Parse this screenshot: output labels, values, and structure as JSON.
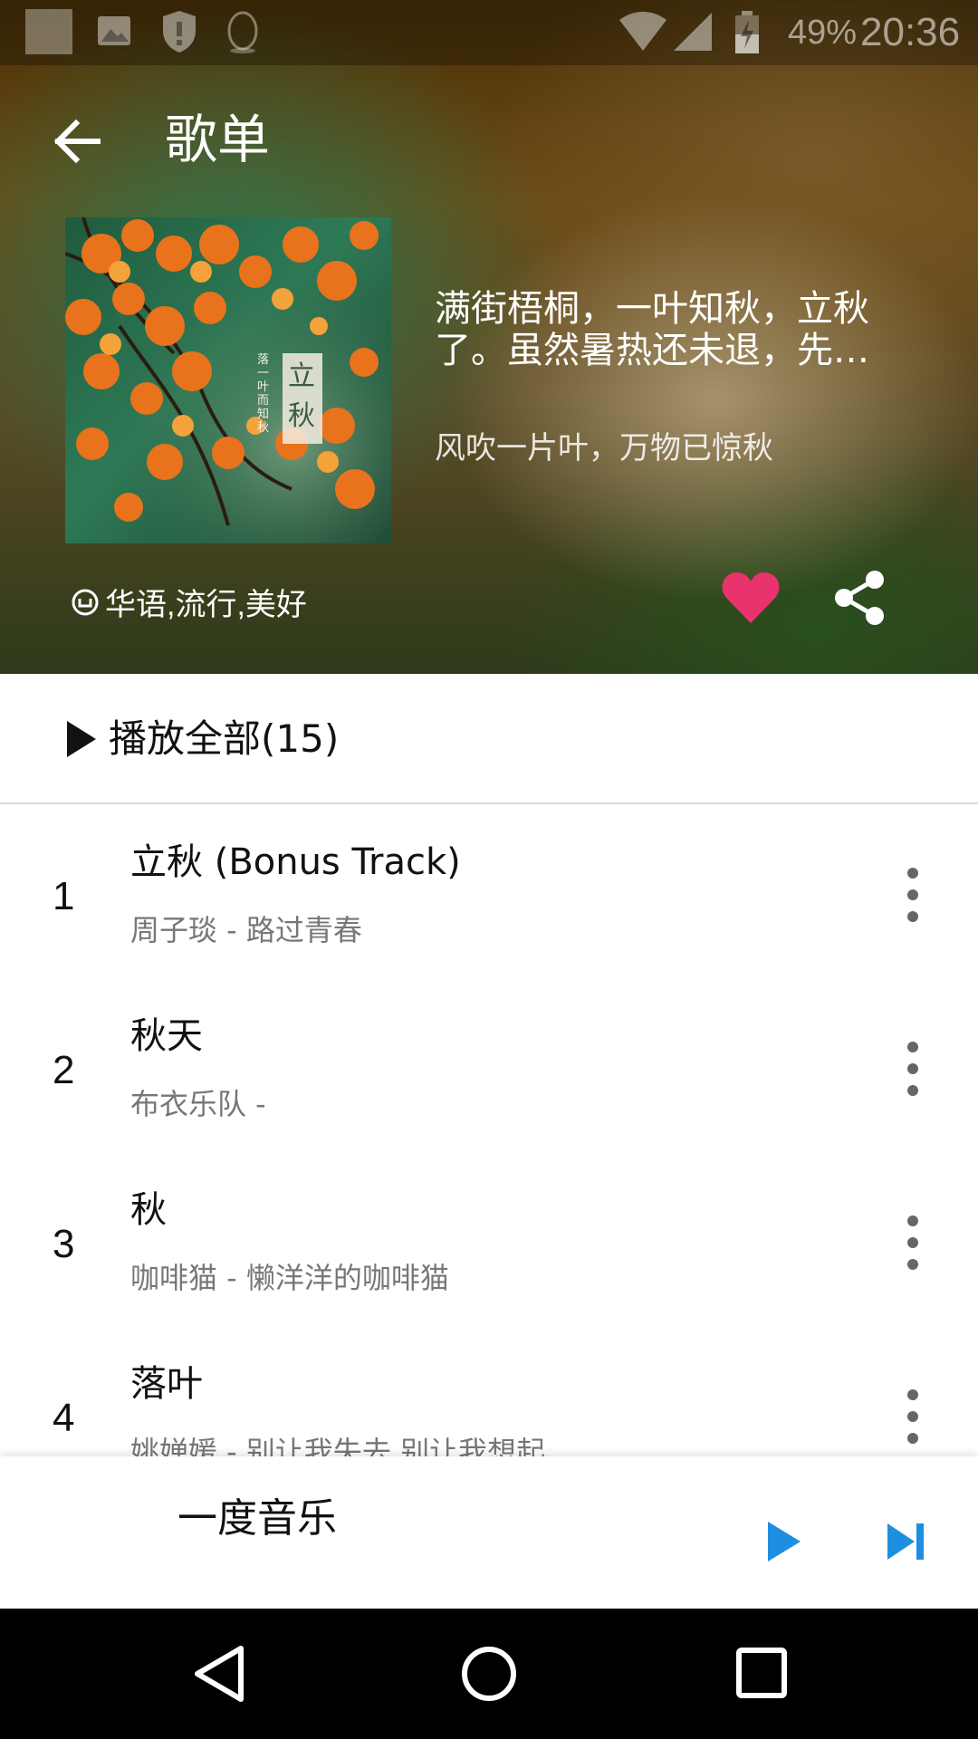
{
  "status_bar": {
    "battery_percent": "49%",
    "time": "20:36",
    "icons": [
      "app-notification-icon",
      "image-icon",
      "shield-icon",
      "qq-penguin-icon",
      "wifi-icon",
      "signal-icon",
      "battery-charging-icon"
    ]
  },
  "toolbar": {
    "title": "歌单",
    "back_icon": "arrow-back-icon"
  },
  "playlist": {
    "cover_text": "立秋",
    "cover_caption": "落一叶而知秋",
    "description_line1": "满街梧桐，一叶知秋，立秋",
    "description_line2": "了。虽然暑热还未退，先…",
    "subtitle": "风吹一片叶，万物已惊秋",
    "tags": "华语,流行,美好",
    "favorited": true,
    "colors": {
      "heart": "#e8336d",
      "accent": "#1e8fe0"
    }
  },
  "play_all": {
    "label": "播放全部(15)"
  },
  "songs": [
    {
      "index": "1",
      "title": "立秋 (Bonus Track)",
      "subtitle": "周子琰 - 路过青春"
    },
    {
      "index": "2",
      "title": "秋天",
      "subtitle": "布衣乐队 -"
    },
    {
      "index": "3",
      "title": "秋",
      "subtitle": "咖啡猫 - 懒洋洋的咖啡猫"
    },
    {
      "index": "4",
      "title": "落叶",
      "subtitle": "姚婵媛 - 别让我失去 别让我想起"
    }
  ],
  "mini_player": {
    "title": "一度音乐"
  },
  "nav_bar": {
    "icons": [
      "back-triangle-icon",
      "home-circle-icon",
      "recents-square-icon"
    ]
  }
}
